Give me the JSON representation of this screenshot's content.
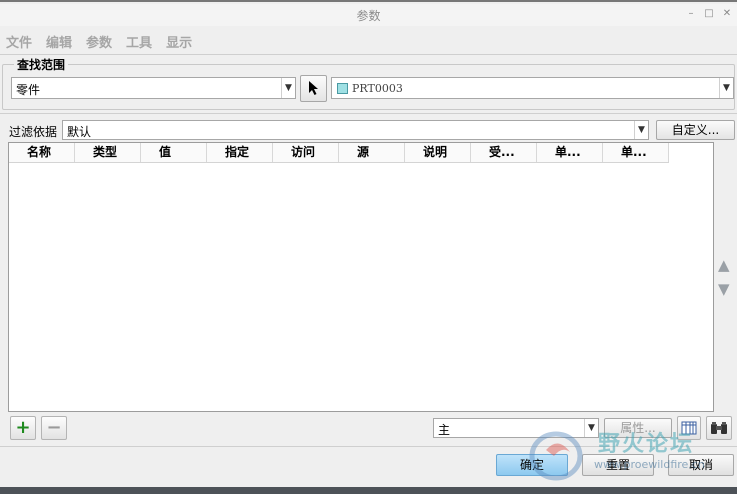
{
  "window": {
    "title": "参数"
  },
  "menu": [
    "文件",
    "编辑",
    "参数",
    "工具",
    "显示"
  ],
  "find_scope": {
    "label": "查找范围",
    "type_value": "零件",
    "object_value": "PRT0003"
  },
  "filter": {
    "label": "过滤依据",
    "value": "默认",
    "customize_label": "自定义..."
  },
  "table": {
    "columns": [
      "名称",
      "类型",
      "值",
      "指定",
      "访问",
      "源",
      "说明",
      "受...",
      "单...",
      "单..."
    ]
  },
  "bottom": {
    "set_value": "主",
    "properties_label": "属性..."
  },
  "actions": {
    "ok": "确定",
    "reset": "重置",
    "cancel": "取消"
  },
  "watermark": {
    "text": "野火论坛",
    "url": "www.proewildfire.cn"
  },
  "icons": {
    "arrow_cursor": "cursor-arrow-icon",
    "part": "part-icon",
    "add": "plus-icon",
    "remove": "minus-icon",
    "up": "triangle-up-icon",
    "down": "triangle-down-icon",
    "columns": "table-columns-icon",
    "binoculars": "binoculars-icon"
  },
  "colors": {
    "accent_ok": "#8dc9ef",
    "add_green": "#1e8a1e"
  }
}
